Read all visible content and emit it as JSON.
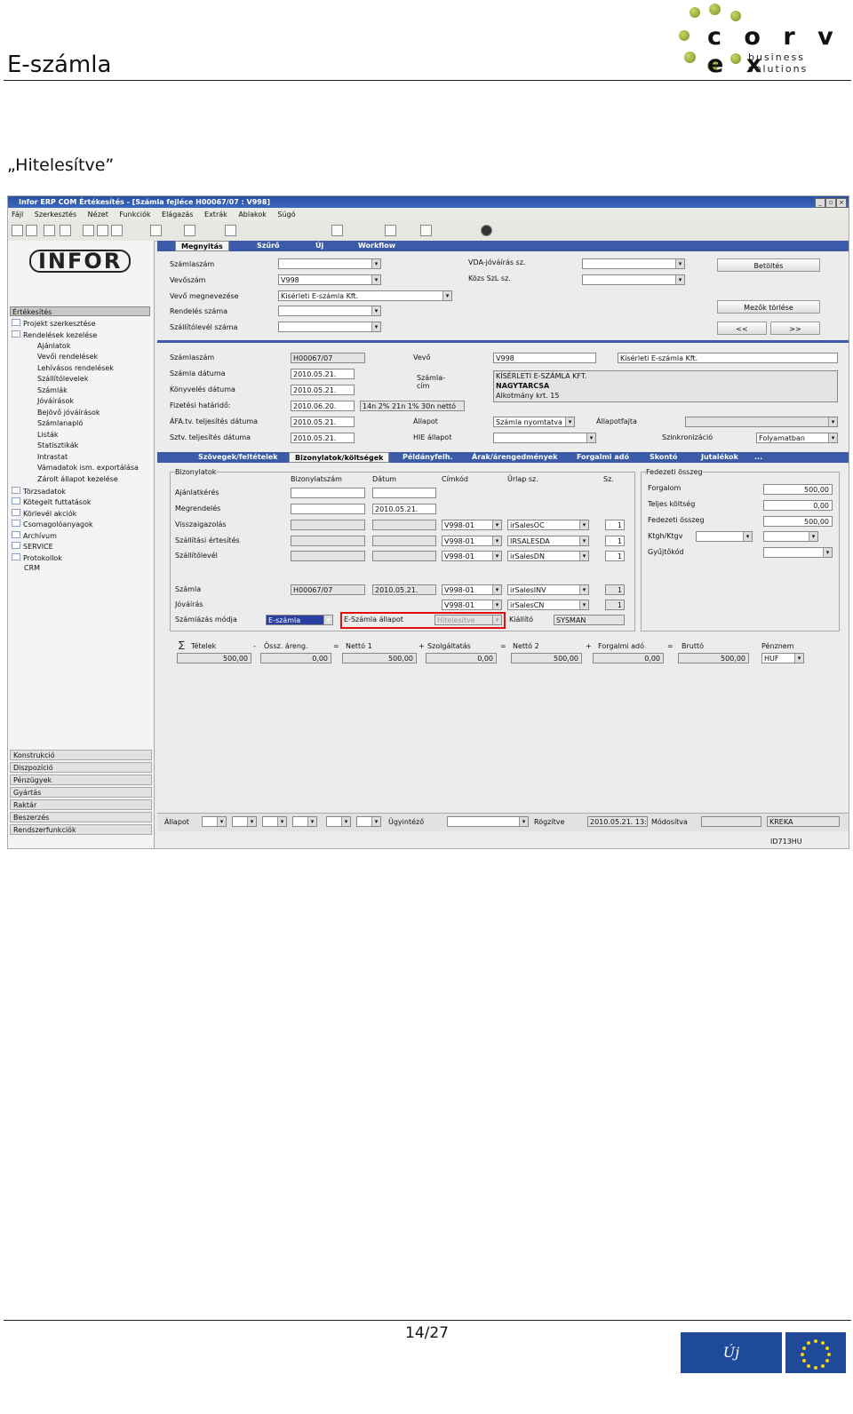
{
  "header": {
    "title": "E-számla",
    "logo_name": "c o r v e x",
    "logo_tagline": "business solutions"
  },
  "section_heading": "„Hitelesítve”",
  "app": {
    "window_title": "Infor ERP COM Értékesítés - [Számla fejléce H00067/07 : V998]",
    "menu": [
      "Fájl",
      "Szerkesztés",
      "Nézet",
      "Funkciók",
      "Elágazás",
      "Extrák",
      "Ablakok",
      "Súgó"
    ],
    "top_tabs": [
      "Megnyitás",
      "Szűrő",
      "Új",
      "Workflow"
    ],
    "sidebar": {
      "logo": "INFOR",
      "header": "Értékesítés",
      "items": [
        "Projekt szerkesztése",
        "Rendelések kezelése",
        "Ajánlatok",
        "Vevői rendelések",
        "Lehívásos rendelések",
        "Szállítólevelek",
        "Számlák",
        "Jóváírások",
        "Bejövő jóváírások",
        "Számlanapló",
        "Listák",
        "Statisztikák",
        "Intrastat",
        "Vámadatok ism. exportálása",
        "Zárolt állapot kezelése",
        "Törzsadatok",
        "Kötegelt futtatások",
        "Körlevél akciók",
        "Csomagolóanyagok",
        "Archívum",
        "SERVICE",
        "Protokollok",
        "CRM"
      ],
      "bottom": [
        "Konstrukció",
        "Diszpozíció",
        "Pénzügyek",
        "Gyártás",
        "Raktár",
        "Beszerzés",
        "Rendszerfunkciók"
      ]
    },
    "search": {
      "szamlaszam": "Számlaszám",
      "vevoszam": "Vevőszám",
      "vevoszam_val": "V998",
      "vevo_megnev": "Vevő megnevezése",
      "vevo_megnev_val": "Kisérleti E-számla Kft.",
      "rendeles": "Rendelés száma",
      "szallitolevel": "Szállítólevél száma",
      "vda": "VDA-jóváírás sz.",
      "kozsz": "Közs SzL sz.",
      "betoltes": "Betöltés",
      "mezok_torlese": "Mezők törlése",
      "prev": "<<",
      "next": ">>"
    },
    "detail": {
      "szamlaszam": "Számlaszám",
      "szamlaszam_val": "H00067/07",
      "szamla_datum": "Számla dátuma",
      "szamla_datum_val": "2010.05.21.",
      "konyveles": "Könyvelés dátuma",
      "konyveles_val": "2010.05.21.",
      "fizetesi": "Fizetési határidő:",
      "fizetesi_val": "2010.06.20.",
      "fizetesi_felt": "14n 2% 21n 1% 30n nettó",
      "afa": "ÁFA.tv. teljesítés dátuma",
      "afa_val": "2010.05.21.",
      "sztv": "Sztv. teljesítés dátuma",
      "sztv_val": "2010.05.21.",
      "vevo": "Vevő",
      "vevo_val": "V998",
      "vevo_nev": "Kísérleti E-számla Kft.",
      "szamlacim": "Számla-\ncím",
      "cim_lines": [
        "KÍSÉRLETI E-SZÁMLA KFT.",
        "NAGYTARCSA",
        "Alkotmány krt. 15"
      ],
      "allapot": "Állapot",
      "allapot_val": "Számla nyomtatva",
      "allapotfajta": "Állapotfajta",
      "hie": "HIE állapot",
      "szinkron": "Szinkronizáció",
      "szinkron_val": "Folyamatban"
    },
    "inner_tabs": [
      "Szövegek/feltételek",
      "Bizonylatok/költségek",
      "Példányfelh.",
      "Árak/árengedmények",
      "Forgalmi adó",
      "Skontó",
      "Jutalékok",
      "..."
    ],
    "bizonylatok": {
      "title": "Bizonylatok",
      "cols": [
        "Bizonylatszám",
        "Dátum",
        "Címkód",
        "Űrlap sz.",
        "Sz."
      ],
      "rows": [
        {
          "label": "Ajánlatkérés",
          "date": "",
          "cim": "",
          "urlap": "",
          "sz": ""
        },
        {
          "label": "Megrendelés",
          "date": "2010.05.21.",
          "cim": "",
          "urlap": "",
          "sz": ""
        },
        {
          "label": "Visszaigazolás",
          "date": "",
          "cim": "V998-01",
          "urlap": "irSalesOC",
          "sz": "1"
        },
        {
          "label": "Szállítási értesítés",
          "date": "",
          "cim": "V998-01",
          "urlap": "IRSALESDA",
          "sz": "1"
        },
        {
          "label": "Szállítólevél",
          "date": "",
          "cim": "V998-01",
          "urlap": "irSalesDN",
          "sz": "1"
        },
        {
          "label": "Számla",
          "num": "H00067/07",
          "date": "2010.05.21.",
          "cim": "V998-01",
          "urlap": "irSalesINV",
          "sz": "1"
        },
        {
          "label": "Jóváírás",
          "date": "",
          "cim": "V998-01",
          "urlap": "irSalesCN",
          "sz": "1"
        }
      ],
      "szamlazas_modja": "Számlázás módja",
      "szamlazas_val": "E-számla",
      "eszamla_allapot": "E-Számla állapot",
      "eszamla_val": "Hitelesítve",
      "kiallito": "Kiállító",
      "kiallito_val": "SYSMAN"
    },
    "fedezeti": {
      "title": "Fedezeti összeg",
      "forgalom": "Forgalom",
      "forgalom_val": "500,00",
      "teljes": "Teljes költség",
      "teljes_val": "0,00",
      "fedezeti": "Fedezeti összeg",
      "fedezeti_val": "500,00",
      "ktgh": "Ktgh/Ktgv",
      "gyujto": "Gyűjtőkód"
    },
    "totals": [
      {
        "label": "Tételek",
        "val": "500,00",
        "op": "-"
      },
      {
        "label": "Össz. áreng.",
        "val": "0,00",
        "op": "="
      },
      {
        "label": "Nettó 1",
        "val": "500,00",
        "op": "+"
      },
      {
        "label": "Szolgáltatás",
        "val": "0,00",
        "op": "="
      },
      {
        "label": "Nettó 2",
        "val": "500,00",
        "op": "+"
      },
      {
        "label": "Forgalmi adó",
        "val": "0,00",
        "op": "="
      },
      {
        "label": "Bruttó",
        "val": "500,00",
        "op": ""
      }
    ],
    "penznem": "Pénznem",
    "penznem_val": "HUF",
    "status": {
      "allapot": "Állapot",
      "ugyintezo": "Ügyintéző",
      "rogzitve": "Rögzítve",
      "rogzitve_val": "2010.05.21. 13:",
      "modositva": "Módosítva",
      "user": "KREKA",
      "id": "ID713HU"
    }
  },
  "footer": {
    "page": "14/27",
    "eu_logo": "Új Magyarország"
  }
}
